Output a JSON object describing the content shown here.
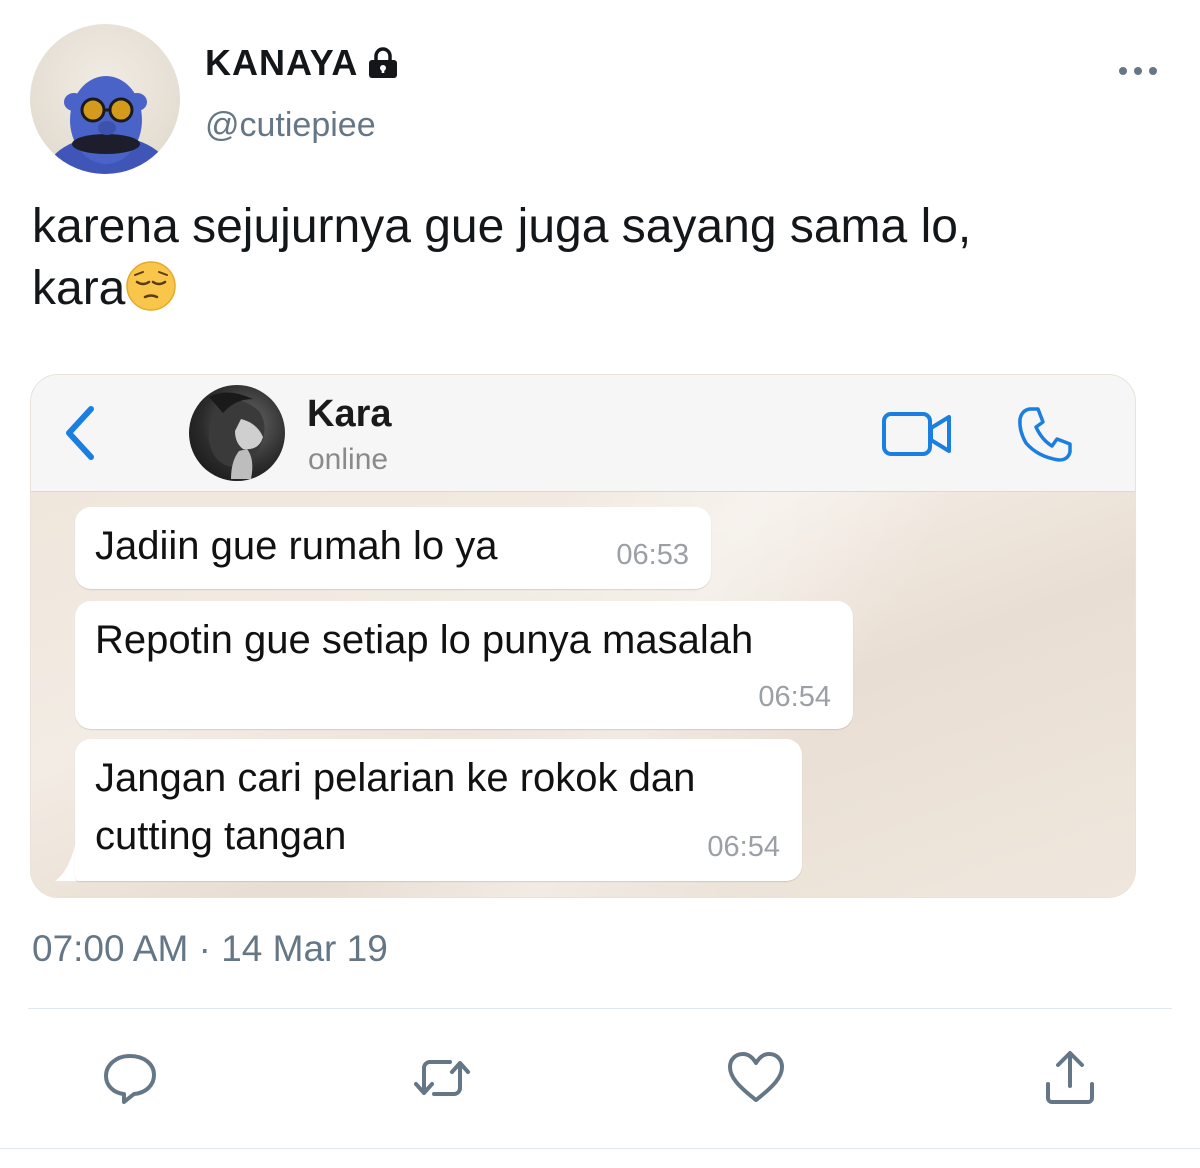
{
  "tweet": {
    "display_name": "KANAYA",
    "handle": "@cutiepiee",
    "text_line1": "karena sejujurnya gue juga sayang sama lo,",
    "text_line2": "kara",
    "timestamp": "07:00 AM · 14 Mar 19"
  },
  "chat": {
    "contact_name": "Kara",
    "status": "online",
    "messages": [
      {
        "text": "Jadiin gue rumah lo ya",
        "time": "06:53"
      },
      {
        "text": "Repotin gue setiap lo punya masalah",
        "time": "06:54"
      },
      {
        "text": "Jangan cari pelarian ke rokok dan cutting tangan",
        "time": "06:54"
      }
    ]
  },
  "icons": {
    "lock": "lock-icon",
    "more": "more-horizontal-icon",
    "back": "chevron-left-icon",
    "video": "video-camera-icon",
    "phone": "phone-icon",
    "reply": "reply-icon",
    "retweet": "retweet-icon",
    "like": "heart-icon",
    "share": "share-icon",
    "emoji": "pensive-face-emoji"
  },
  "colors": {
    "text_primary": "#14171a",
    "text_secondary": "#657786",
    "ios_blue": "#1a7fe0",
    "divider": "#e1e8ed"
  }
}
